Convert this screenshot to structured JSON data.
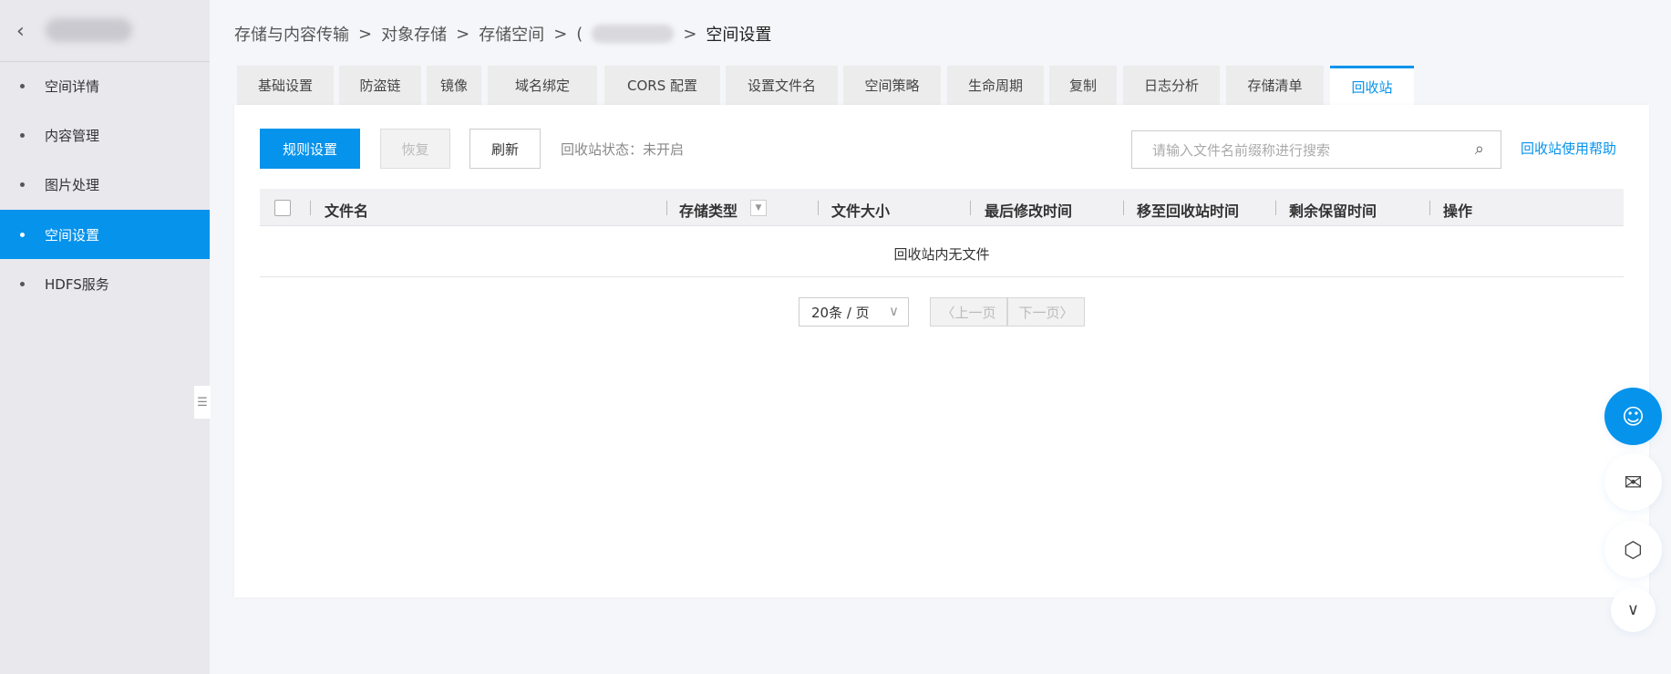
{
  "sidebar": {
    "back_icon": "chevron-left-icon",
    "items": [
      {
        "label": "空间详情"
      },
      {
        "label": "内容管理"
      },
      {
        "label": "图片处理"
      },
      {
        "label": "空间设置",
        "active": true
      },
      {
        "label": "HDFS服务"
      }
    ]
  },
  "breadcrumb": [
    "存储与内容传输",
    ">",
    "对象存储",
    ">",
    "存储空间",
    ">",
    "(",
    ">",
    "空间设置"
  ],
  "tabs": [
    "基础设置",
    "防盗链",
    "镜像",
    "域名绑定",
    "CORS 配置",
    "设置文件名",
    "空间策略",
    "生命周期",
    "复制",
    "日志分析",
    "存储清单",
    "回收站"
  ],
  "toolbar": {
    "rule_btn": "规则设置",
    "restore_btn": "恢复",
    "refresh_btn": "刷新",
    "status": "回收站状态：未开启",
    "search_placeholder": "请输入文件名前缀称进行搜索",
    "help_link": "回收站使用帮助"
  },
  "table": {
    "columns": [
      "文件名",
      "存储类型",
      "文件大小",
      "最后修改时间",
      "移至回收站时间",
      "剩余保留时间",
      "操作"
    ],
    "empty": "回收站内无文件"
  },
  "pagination": {
    "page_size": "20条 / 页",
    "prev": "〈上一页",
    "next": "下一页〉"
  },
  "colors": {
    "accent": "#0593ec"
  }
}
